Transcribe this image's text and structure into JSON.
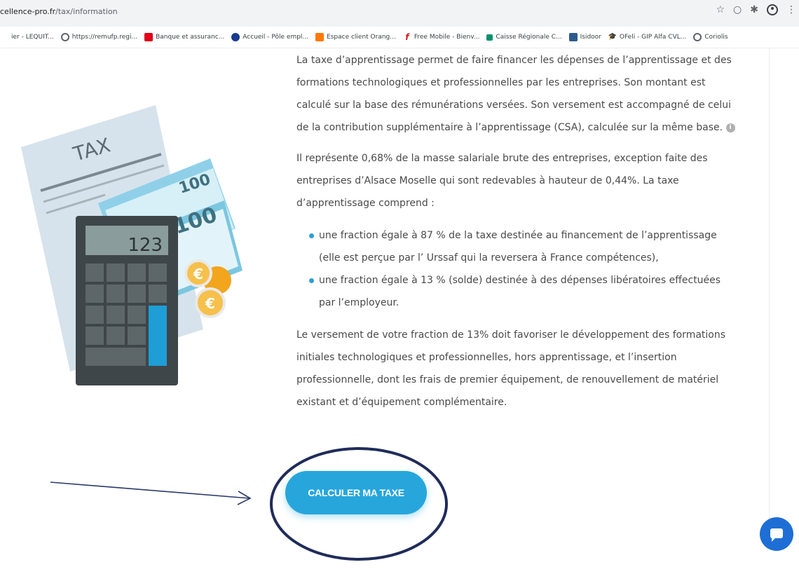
{
  "browser": {
    "url_domain": "cellence-pro.fr",
    "url_path": "/tax/information",
    "icons": [
      "star-icon",
      "extension-icon",
      "puzzle-icon",
      "profile-icon",
      "menu-icon"
    ],
    "star": "☆",
    "ext": "○",
    "puzzle": "✱",
    "menu": "⋮"
  },
  "bookmarks": [
    {
      "label": "ier - LEQUIT...",
      "color": "#ffffff"
    },
    {
      "label": "https://remufp.regi...",
      "color": "#5f6368"
    },
    {
      "label": "Banque et assuranc...",
      "color": "#e2001a"
    },
    {
      "label": "Accueil - Pôle empl...",
      "color": "#1a3a8f"
    },
    {
      "label": "Espace client Orang...",
      "color": "#ff7900"
    },
    {
      "label": "Free Mobile - Bienv...",
      "color": "#cd1e25"
    },
    {
      "label": "Caisse Régionale C...",
      "color": "#00916e"
    },
    {
      "label": "Isidoor",
      "color": "#2d5b8c"
    },
    {
      "label": "OFeli - GIP Alfa CVL...",
      "color": "#222222"
    },
    {
      "label": "Coriolis",
      "color": "#5f6368"
    }
  ],
  "bookmark_glyphs": [
    "",
    "",
    "",
    "",
    "",
    "f",
    "",
    "",
    "🎓",
    ""
  ],
  "illustration": {
    "tax_label": "TAX",
    "bill_value": "100",
    "bill_value_back": "100",
    "display_value": "123",
    "coin_symbol": "€"
  },
  "article": {
    "p1": "La taxe d’apprentissage permet de faire financer les dépenses de l’apprentissage et des formations technologiques et professionnelles par les entreprises. Son montant est calculé sur la base des rémunérations versées. Son versement est accompagné de celui de la contribution supplémentaire à l’apprentissage (CSA), calculée sur la même base.",
    "info_glyph": "i",
    "p2": "Il représente 0,68% de la masse salariale brute des entreprises, exception faite des entreprises d’Alsace Moselle qui sont redevables à hauteur de 0,44%. La taxe d’apprentissage comprend :",
    "bullets": [
      "une fraction égale à 87 % de la taxe destinée au financement de l’apprentissage (elle est perçue par l’ Urssaf qui la reversera à France compétences),",
      "une fraction égale à 13 % (solde) destinée à des dépenses libératoires effectuées par l’employeur."
    ],
    "p3": "Le versement de votre fraction de 13% doit favoriser le développement des formations initiales technologiques et professionnelles, hors apprentissage, et l’insertion professionnelle, dont les frais de premier équipement, de renouvellement de matériel existant et d’équipement complémentaire."
  },
  "cta": {
    "label": "CALCULER MA TAXE"
  },
  "colors": {
    "accent": "#27a6dc",
    "annotation": "#2b3a6b",
    "chat": "#1e6ed6"
  }
}
